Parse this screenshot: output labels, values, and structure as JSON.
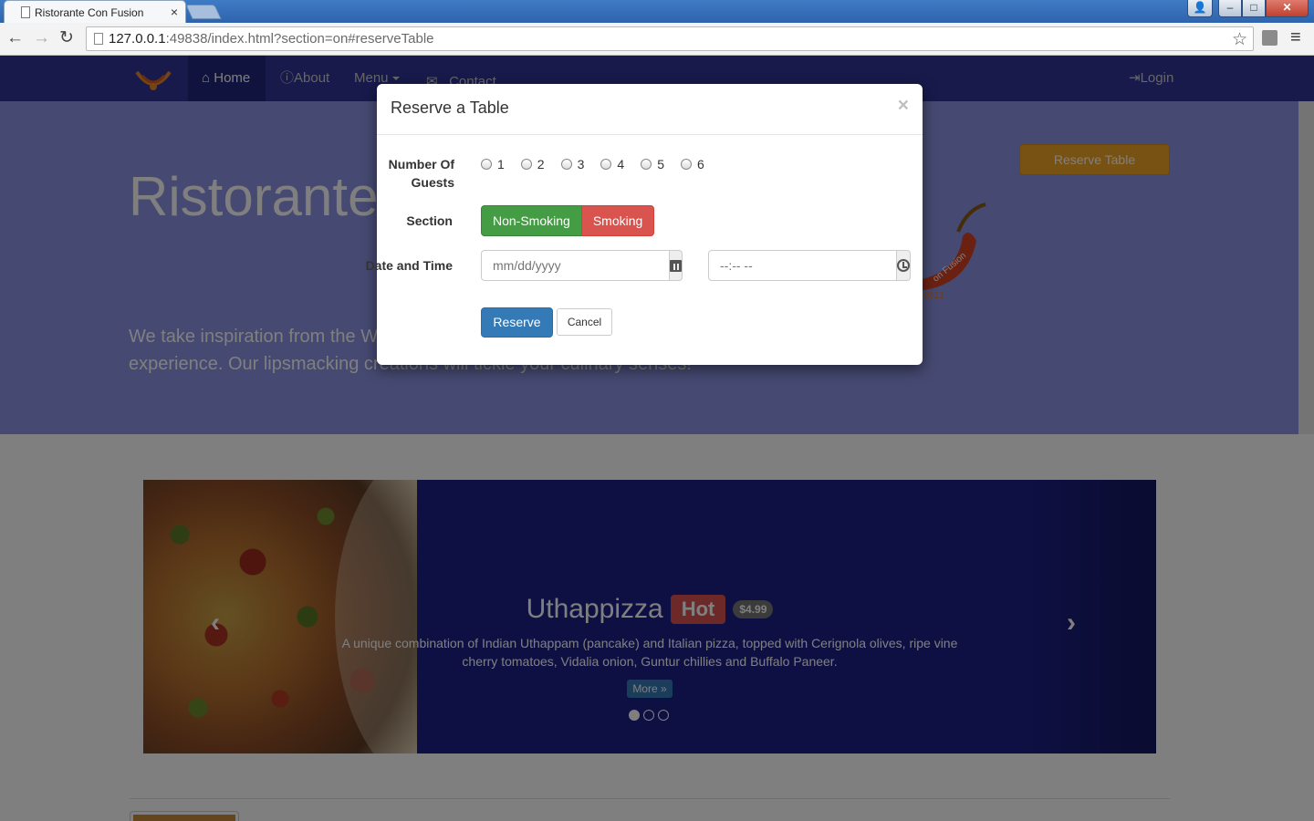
{
  "browser": {
    "tab_title": "Ristorante Con Fusion",
    "tab_close": "×",
    "url_host": "127.0.0.1",
    "url_rest": ":49838/index.html?section=on#reserveTable",
    "window_buttons": {
      "minimize": "–",
      "maximize": "□",
      "close": "✕"
    }
  },
  "navbar": {
    "items": [
      {
        "label": "Home",
        "icon": "home-icon",
        "active": true
      },
      {
        "label": "About",
        "icon": "info-icon"
      },
      {
        "label": "Menu",
        "icon": "caret-down-icon"
      },
      {
        "label": "Contact",
        "icon": "envelope-icon"
      }
    ],
    "login": "Login"
  },
  "jumbotron": {
    "title": "Ristorante",
    "text_visible_left": "We take inspiration from the W",
    "text_line2_left": "experience. Our lipsmacking",
    "text_line2_right": "creations will tickle your culinary senses!",
    "reserve_button": "Reserve Table"
  },
  "carousel": {
    "name": "Uthappizza",
    "label": "Hot",
    "price": "$4.99",
    "description": "A unique combination of Indian Uthappam (pancake) and Italian pizza, topped with Cerignola olives, ripe vine cherry tomatoes, Vidalia onion, Guntur chillies and Buffalo Paneer.",
    "more": "More »",
    "slides": 3,
    "active_slide": 1
  },
  "modal": {
    "title": "Reserve a Table",
    "close": "×",
    "guests_label": "Number Of Guests",
    "guest_options": [
      "1",
      "2",
      "3",
      "4",
      "5",
      "6"
    ],
    "section_label": "Section",
    "section_options": [
      "Non-Smoking",
      "Smoking"
    ],
    "datetime_label": "Date and Time",
    "date_placeholder": "mm/dd/yyyy",
    "time_placeholder": "--:-- --",
    "reserve_button": "Reserve",
    "cancel_button": "Cancel"
  },
  "colors": {
    "navbar": "#2e3597",
    "jumbotron": "#8d93e3",
    "success": "#449d44",
    "danger": "#d9534f",
    "primary": "#337ab7",
    "warning": "#f0a526"
  }
}
